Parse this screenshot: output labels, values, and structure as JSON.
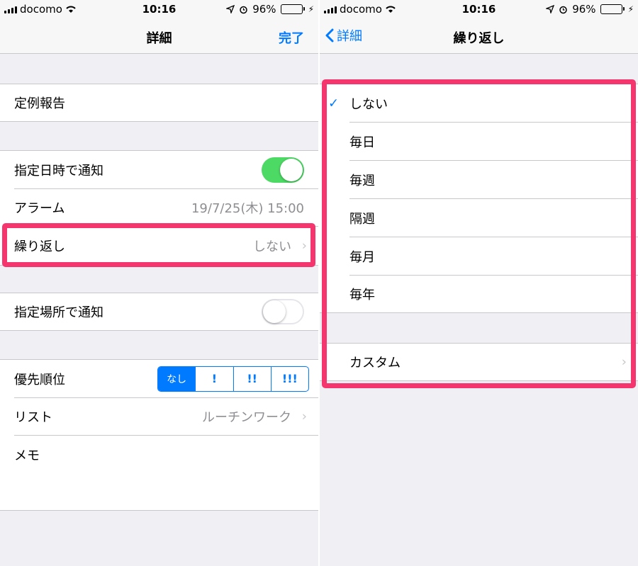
{
  "colors": {
    "accent": "#007aff",
    "toggle_on": "#4cd964",
    "highlight": "#f5356e",
    "battery": "#4cd964"
  },
  "left": {
    "status": {
      "carrier": "docomo",
      "time": "10:16",
      "battery": "96%"
    },
    "nav": {
      "title": "詳細",
      "done": "完了"
    },
    "title_row": "定例報告",
    "notify_date": {
      "label": "指定日時で通知",
      "toggle": true
    },
    "alarm": {
      "label": "アラーム",
      "value": "19/7/25(木) 15:00"
    },
    "repeat": {
      "label": "繰り返し",
      "value": "しない"
    },
    "notify_location": {
      "label": "指定場所で通知",
      "toggle": false
    },
    "priority": {
      "label": "優先順位",
      "options": [
        "なし",
        "!",
        "!!",
        "!!!"
      ],
      "selected": "なし"
    },
    "list": {
      "label": "リスト",
      "value": "ルーチンワーク"
    },
    "memo": {
      "label": "メモ"
    }
  },
  "right": {
    "status": {
      "carrier": "docomo",
      "time": "10:16",
      "battery": "96%"
    },
    "nav": {
      "back": "詳細",
      "title": "繰り返し"
    },
    "options": [
      "しない",
      "毎日",
      "毎週",
      "隔週",
      "毎月",
      "毎年"
    ],
    "selected": "しない",
    "custom": "カスタム"
  }
}
